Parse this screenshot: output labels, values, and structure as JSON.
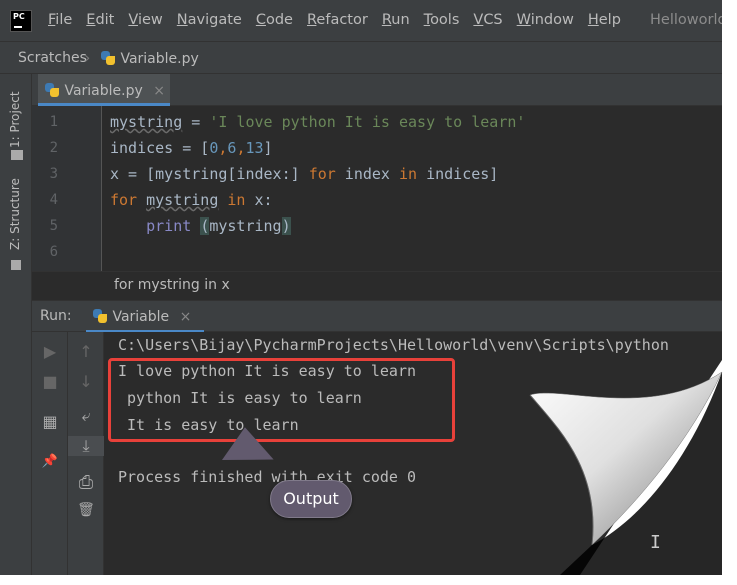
{
  "app": {
    "logo_text": "PC",
    "window_title": "Helloworld"
  },
  "menu": [
    "File",
    "Edit",
    "View",
    "Navigate",
    "Code",
    "Refactor",
    "Run",
    "Tools",
    "VCS",
    "Window",
    "Help"
  ],
  "breadcrumb": {
    "folder": "Scratches",
    "file": "Variable.py"
  },
  "left_strip": {
    "project_tab": "1: Project",
    "structure_tab": "Z: Structure"
  },
  "editor_tab": {
    "label": "Variable.py",
    "close": "×"
  },
  "code": {
    "line_numbers": [
      "1",
      "2",
      "3",
      "4",
      "5",
      "6"
    ],
    "l1_var": "mystring",
    "l1_eq": " = ",
    "l1_str": "'I love python It is easy to learn'",
    "l2_a": "indices = [",
    "l2_n0": "0",
    "l2_c1": ",",
    "l2_n1": "6",
    "l2_c2": ",",
    "l2_n2": "13",
    "l2_b": "]",
    "l3_a": "x = [mystring[index:] ",
    "l3_for": "for",
    "l3_b": " index ",
    "l3_in": "in",
    "l3_c": " indices]",
    "l4_for": "for",
    "l4_var": "mystring",
    "l4_in": "in",
    "l4_b": " x:",
    "l5_indent": "    ",
    "l5_print": "print",
    "l5_sp": " ",
    "l5_open": "(",
    "l5_arg": "mystring",
    "l5_close": ")"
  },
  "editor_breadcrumb": "for mystring in x",
  "run": {
    "label": "Run:",
    "tab": "Variable",
    "close": "×",
    "console": {
      "command": "C:\\Users\\Bijay\\PycharmProjects\\Helloworld\\venv\\Scripts\\python",
      "out1": "I love python It is easy to learn",
      "out2": " python It is easy to learn",
      "out3": " It is easy to learn",
      "exit": "Process finished with exit code 0"
    }
  },
  "callout": {
    "text": "Output"
  },
  "icons": {
    "run": "▶",
    "stop": "■",
    "layout": "▦",
    "pin": "📌",
    "up": "↑",
    "down": "↓",
    "wrap": "⤶",
    "scroll_end": "⤓",
    "print": "⎙",
    "trash": "🗑",
    "cursor": "I"
  },
  "colors": {
    "highlight": "#e8413a",
    "callout_bg": "#625a6e",
    "keyword": "#cc7832",
    "string": "#6a8759",
    "number": "#6897bb"
  }
}
